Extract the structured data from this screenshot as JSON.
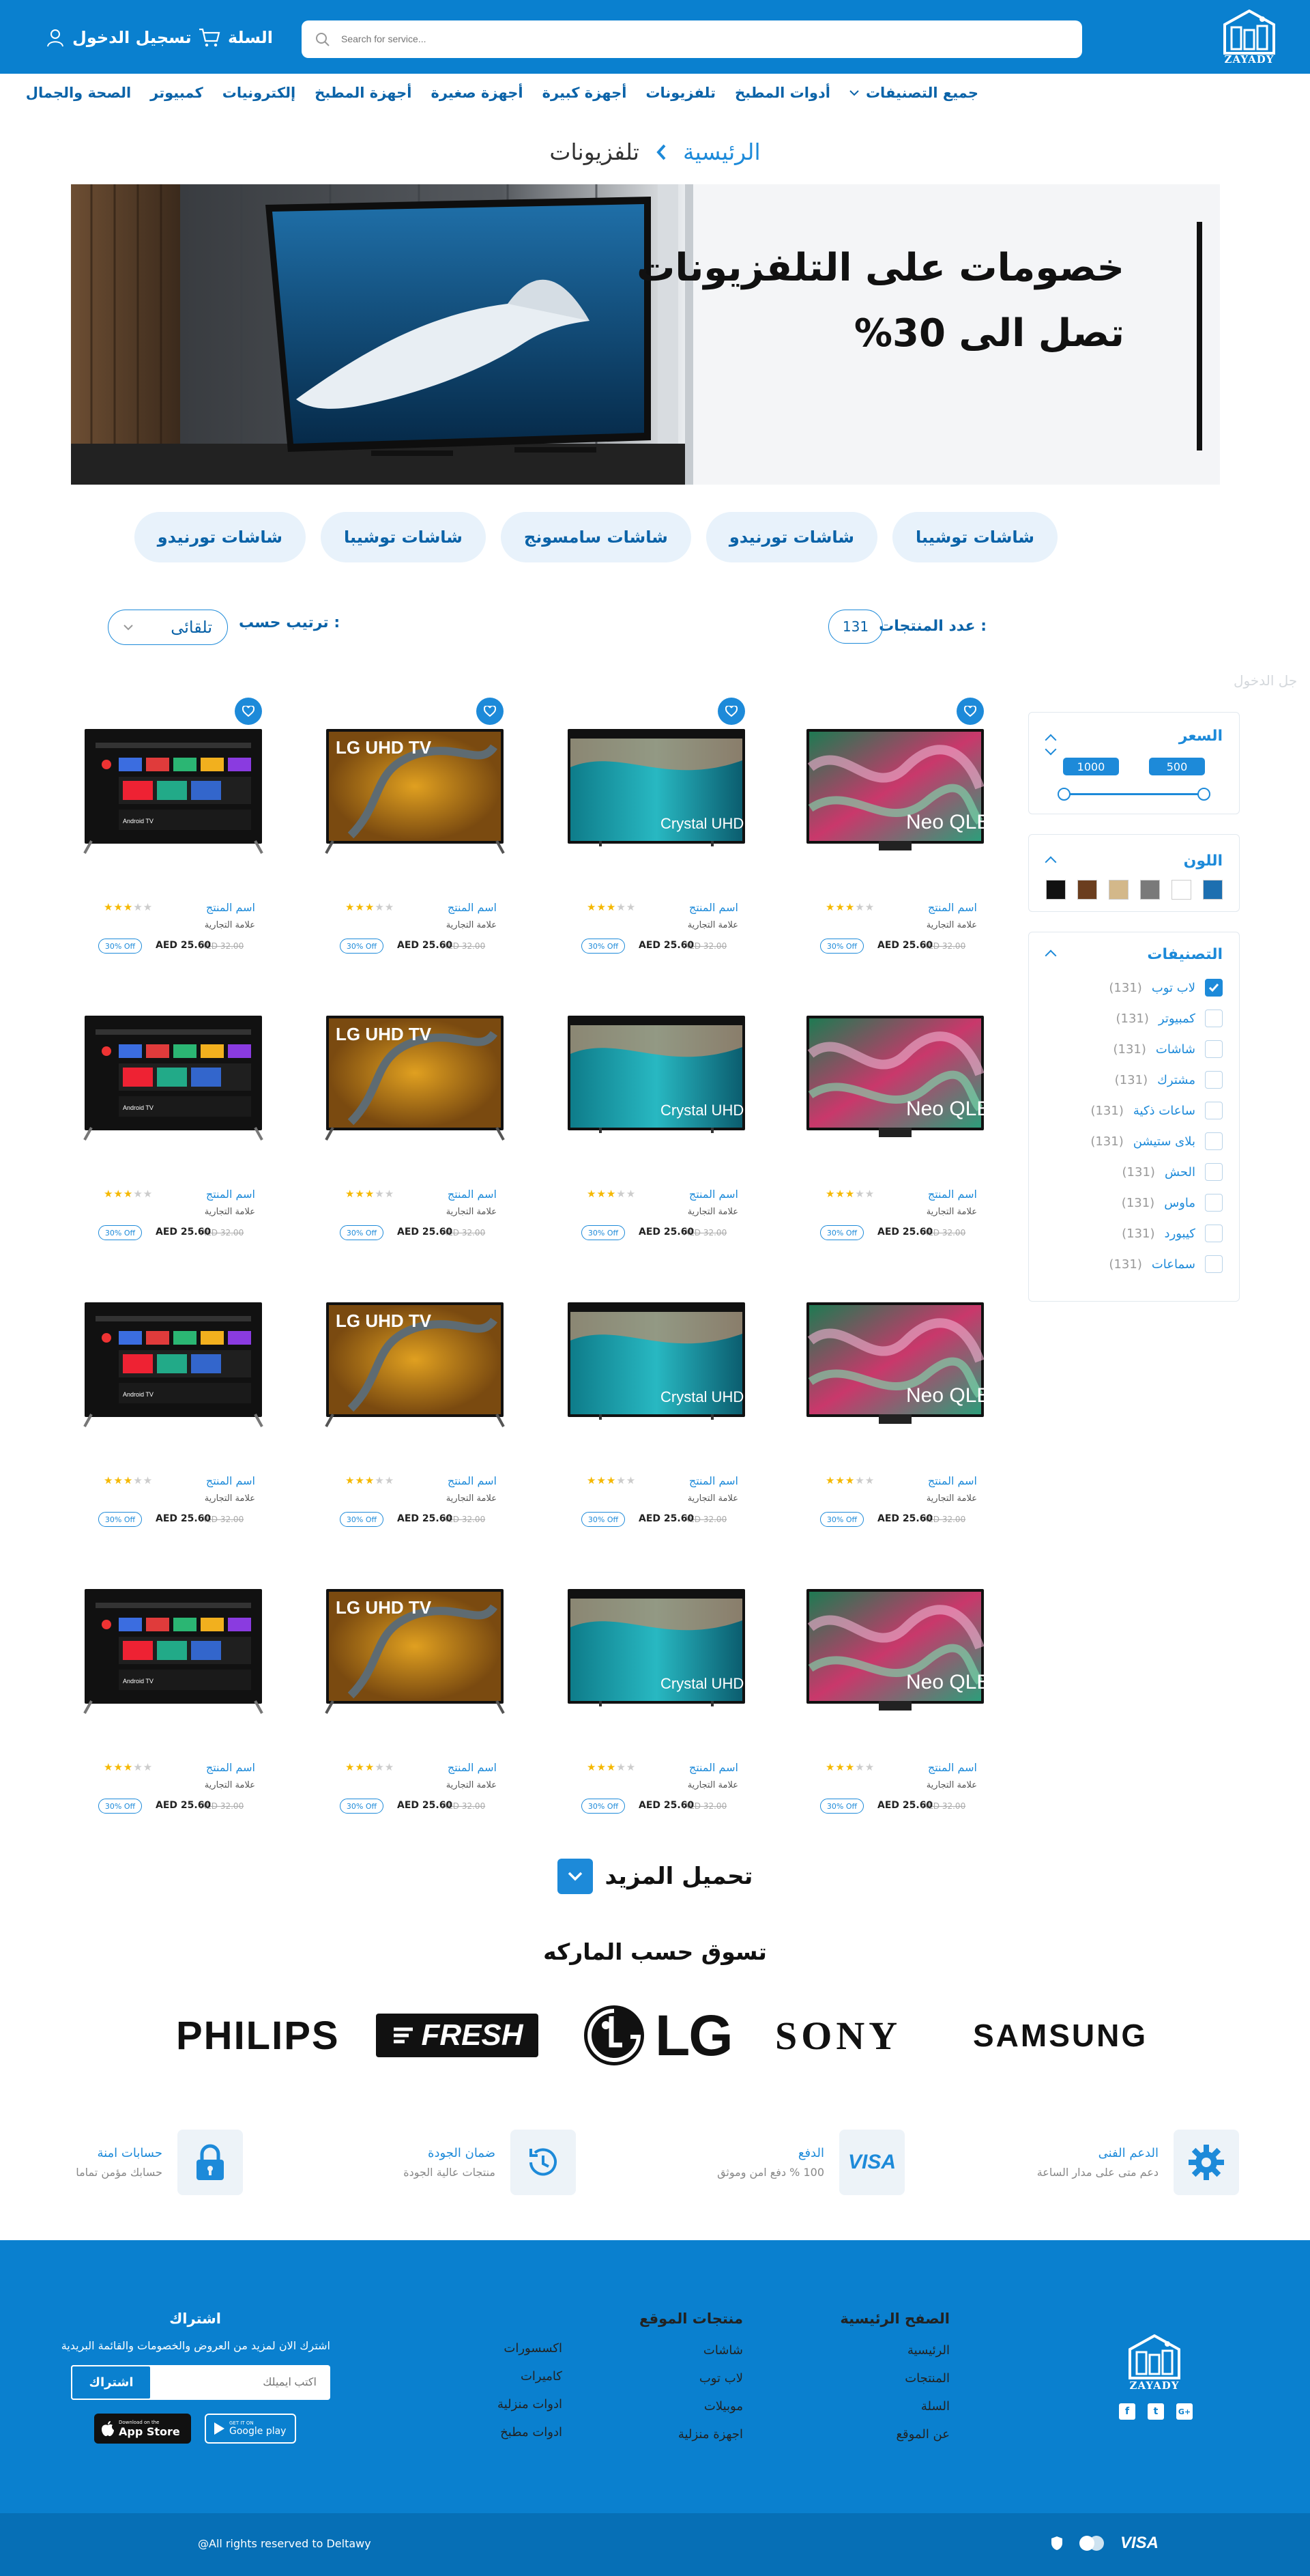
{
  "header": {
    "logo_text": "ZAYADY",
    "search_placeholder": "Search for service...",
    "cart_label": "السلة",
    "login_label": "تسجيل الدخول"
  },
  "nav": [
    "جميع التصنيفات",
    "أدوات المطبخ",
    "تلفزيونات",
    "أجهزة كبيرة",
    "أجهزة صغيرة",
    "أجهزة المطبخ",
    "إلكترونيات",
    "كمبيوتر",
    "الصحة والجمال"
  ],
  "breadcrumb": {
    "home": "الرئيسية",
    "current": "تلفزيونات"
  },
  "banner": {
    "line1": "خصومات على التلفزيونات",
    "line2": "تصل الى 30%"
  },
  "brand_chips": [
    "شاشات توشيبا",
    "شاشات تورنيدو",
    "شاشات سامسونج",
    "شاشات توشيبا",
    "شاشات تورنيدو"
  ],
  "toolbar": {
    "count_label": "عدد المنتجات :",
    "count": "131",
    "sort_label": "ترتيب حسب :",
    "sort_value": "تلقائى"
  },
  "ghost_text": "جل الدخول",
  "filters": {
    "price": {
      "title": "السعر",
      "min": "500",
      "max": "1000"
    },
    "color": {
      "title": "اللون",
      "swatches": [
        "#1d6fb0",
        "#ffffff",
        "#7a7a7a",
        "#d3b88a",
        "#6b3e1f",
        "#111111"
      ]
    },
    "categories": {
      "title": "التصنيفات",
      "items": [
        {
          "name": "لاب توب",
          "count": "(131)",
          "checked": true
        },
        {
          "name": "كمبيوتر",
          "count": "(131)",
          "checked": false
        },
        {
          "name": "شاشات",
          "count": "(131)",
          "checked": false
        },
        {
          "name": "مشترك",
          "count": "(131)",
          "checked": false
        },
        {
          "name": "ساعات ذكية",
          "count": "(131)",
          "checked": false
        },
        {
          "name": "بلاى ستيشن",
          "count": "(131)",
          "checked": false
        },
        {
          "name": "الحش",
          "count": "(131)",
          "checked": false
        },
        {
          "name": "ماوس",
          "count": "(131)",
          "checked": false
        },
        {
          "name": "كيبورد",
          "count": "(131)",
          "checked": false
        },
        {
          "name": "سماعات",
          "count": "(131)",
          "checked": false
        }
      ]
    }
  },
  "product": {
    "name": "اسم المنتج",
    "brand": "علامة التجارية",
    "old_price": "AED 32.00",
    "price": "AED 25.60",
    "discount": "30% Off",
    "stars": "★★★☆☆"
  },
  "product_images": [
    "Neo QLED",
    "Crystal UHD",
    "LG UHD TV",
    "Android TV"
  ],
  "load_more": "تحميل المزيد",
  "brands_title": "تسوق حسب الماركه",
  "brands": [
    "SAMSUNG",
    "SONY",
    "LG",
    "FRESH",
    "PHILIPS"
  ],
  "features": [
    {
      "title": "الدعم الفنى",
      "sub": "دعم متى على مدار الساعة"
    },
    {
      "title": "الدفع",
      "sub": "100 % دفع امن وموثق"
    },
    {
      "title": "ضمان الجودة",
      "sub": "منتجات عالية الجودة"
    },
    {
      "title": "حسابات امنة",
      "sub": "حسابك مؤمن تماما"
    }
  ],
  "footer": {
    "col1": {
      "title": "الصفح الرئيسية",
      "links": [
        "الرئيسية",
        "المنتجات",
        "السلة",
        "عن الموقع"
      ]
    },
    "col2": {
      "title": "منتجات الموقع",
      "links": [
        "شاشات",
        "لاب توب",
        "موبيلات",
        "اجهزة منزلية"
      ]
    },
    "col3": {
      "links": [
        "اكسسورات",
        "كاميرات",
        "ادوات منزلية",
        "ادوات مطبخ"
      ]
    },
    "subscribe": {
      "title": "اشتراك",
      "text": "اشترك الان لمزيد من العروض والخصومات والقائمة البريدية",
      "placeholder": "اكتب ايميلك",
      "button": "اشتراك"
    },
    "app_store": {
      "small": "Download on the",
      "big": "App Store"
    },
    "google_play": {
      "small": "GET IT ON",
      "big": "Google play"
    },
    "copyright": "@All rights reserved to Deltawy",
    "payment": "VISA"
  },
  "colors": {
    "primary": "#0a80cf",
    "accent": "#1d8ad9"
  }
}
